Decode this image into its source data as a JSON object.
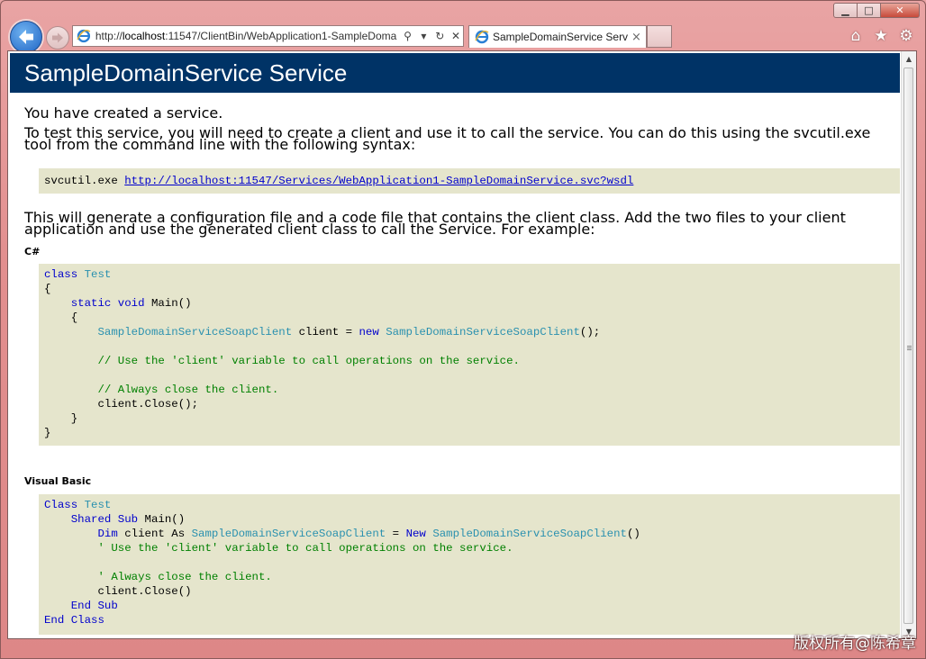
{
  "browser": {
    "address_url_prefix": "http://",
    "address_url_host": "localhost",
    "address_url_rest": ":11547/ClientBin/WebApplication1-SampleDoma",
    "tab_title": "SampleDomainService Servi...",
    "tab_close": "×",
    "window_controls": {
      "minimize": "▁",
      "maximize": "□",
      "close": "✕"
    },
    "colors": {
      "accent": "#1f64c4",
      "header": "#003366",
      "code_bg": "#e5e5cc"
    }
  },
  "page": {
    "title": "SampleDomainService Service",
    "p_created": "You have created a service.",
    "p_test": "To test this service, you will need to create a client and use it to call the service. You can do this using the svcutil.exe tool from the command line with the following syntax:",
    "svcutil_cmd": "svcutil.exe ",
    "svcutil_link": "http://localhost:11547/Services/WebApplication1-SampleDomainService.svc?wsdl",
    "p_generate": "This will generate a configuration file and a code file that contains the client class. Add the two files to your client application and use the generated client class to call the Service. For example:",
    "heading_cs": "C#",
    "heading_vb": "Visual Basic"
  },
  "code_cs": {
    "l1_kw": "class",
    "l1_ty": "Test",
    "l2": "{",
    "l3_kw": "static void",
    "l3_rest": " Main()",
    "l4": "{",
    "l5_ty": "SampleDomainServiceSoapClient",
    "l5_mid": " client = ",
    "l5_kw": "new",
    "l5_ty2": "SampleDomainServiceSoapClient",
    "l5_end": "();",
    "l6_cm": "// Use the 'client' variable to call operations on the service.",
    "l7_cm": "// Always close the client.",
    "l8": "client.Close();",
    "l9": "}",
    "l10": "}"
  },
  "code_vb": {
    "l1_kw": "Class",
    "l1_ty": "Test",
    "l2_kw": "Shared Sub",
    "l2_rest": " Main()",
    "l3_kw": "Dim",
    "l3_mid": " client As ",
    "l3_ty": "SampleDomainServiceSoapClient",
    "l3_eq": " = ",
    "l3_kw2": "New",
    "l3_ty2": "SampleDomainServiceSoapClient",
    "l3_end": "()",
    "l4_cm": "' Use the 'client' variable to call operations on the service.",
    "l5_cm": "' Always close the client.",
    "l6": "client.Close()",
    "l7_kw": "End Sub",
    "l8_kw": "End Class"
  },
  "watermark": "版权所有@陈希章"
}
